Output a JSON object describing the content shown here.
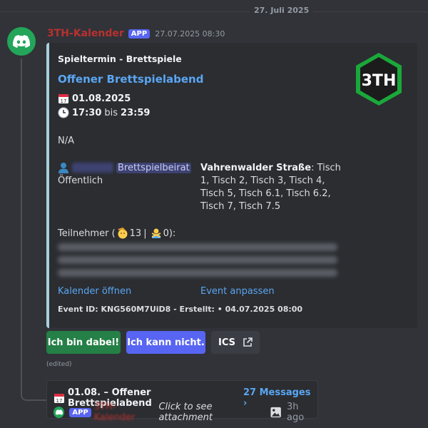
{
  "date_divider": "27. Juli 2025",
  "message": {
    "username": "3TH-Kalender",
    "badge": "APP",
    "timestamp": "27.07.2025 08:30",
    "edited": "(edited)"
  },
  "embed": {
    "author": "Spieltermin - Brettspiele",
    "title": "Offener Brettspielabend",
    "date": "01.08.2025",
    "time_start": "17:30",
    "time_between": "bis",
    "time_end": "23:59",
    "description": "N/A",
    "host_role": "Brettspielbeirat",
    "visibility": "Öffentlich",
    "location_name": "Vahrenwalder Straße",
    "location_tables": ": Tisch 1, Tisch 2, Tisch 3, Tisch 4, Tisch 5, Tisch 6.1, Tisch 6.2, Tisch 7, Tisch 7.5",
    "participants_label": "Teilnehmer (",
    "participants_yes": "13",
    "participants_sep": "|",
    "participants_no": "0):",
    "link_calendar": "Kalender öffnen",
    "link_edit": "Event anpassen",
    "footer": "Event ID: KNG560M7UiD8 - Erstellt: • 04.07.2025 08:00",
    "thumbnail_text": "3TH",
    "accent_color": "#a6d0dc"
  },
  "buttons": {
    "attend": "Ich bin dabei!",
    "decline": "Ich kann nicht.",
    "ics": "ICS"
  },
  "thread": {
    "title": "01.08. – Offener Brettspielabend",
    "count": "27 Messages ›",
    "badge": "APP",
    "username": "3TH-Kalender",
    "preview": "Click to see attachment",
    "time": "3h ago"
  },
  "colors": {
    "background": "#313338",
    "embed_bg": "#2b2d31",
    "link": "#5aa6f2",
    "success": "#248046",
    "blurple": "#5865f2",
    "username": "#b8312f"
  }
}
